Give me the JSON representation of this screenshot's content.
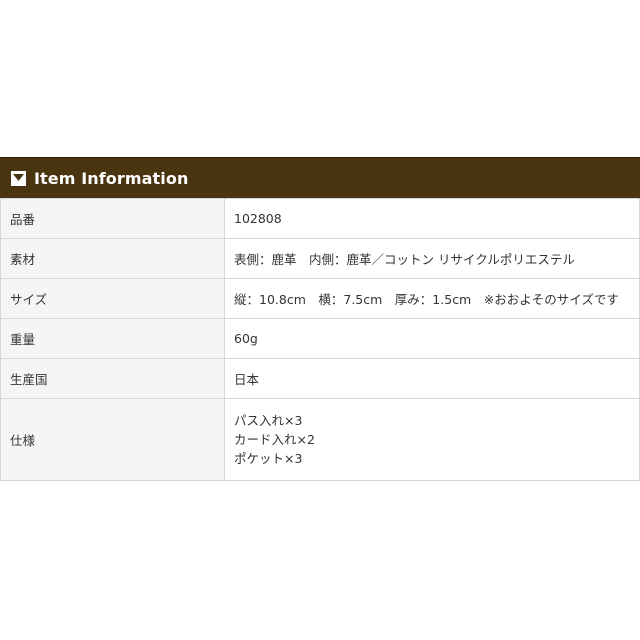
{
  "header": {
    "title": "Item Information",
    "icon": "triangle-down-icon"
  },
  "rows": [
    {
      "label": "品番",
      "value": "102808"
    },
    {
      "label": "素材",
      "value": "表側：鹿革　内側：鹿革／コットン リサイクルポリエステル"
    },
    {
      "label": "サイズ",
      "value": "縦：10.8cm　横：7.5cm　厚み：1.5cm　※おおよそのサイズです"
    },
    {
      "label": "重量",
      "value": "60g"
    },
    {
      "label": "生産国",
      "value": "日本"
    }
  ],
  "spec": {
    "label": "仕様",
    "lines": [
      "パス入れ×3",
      "カード入れ×2",
      "ポケット×3"
    ]
  },
  "colors": {
    "header_bg": "#4a3511",
    "label_bg": "#f5f5f5",
    "border": "#d6d6d6"
  }
}
